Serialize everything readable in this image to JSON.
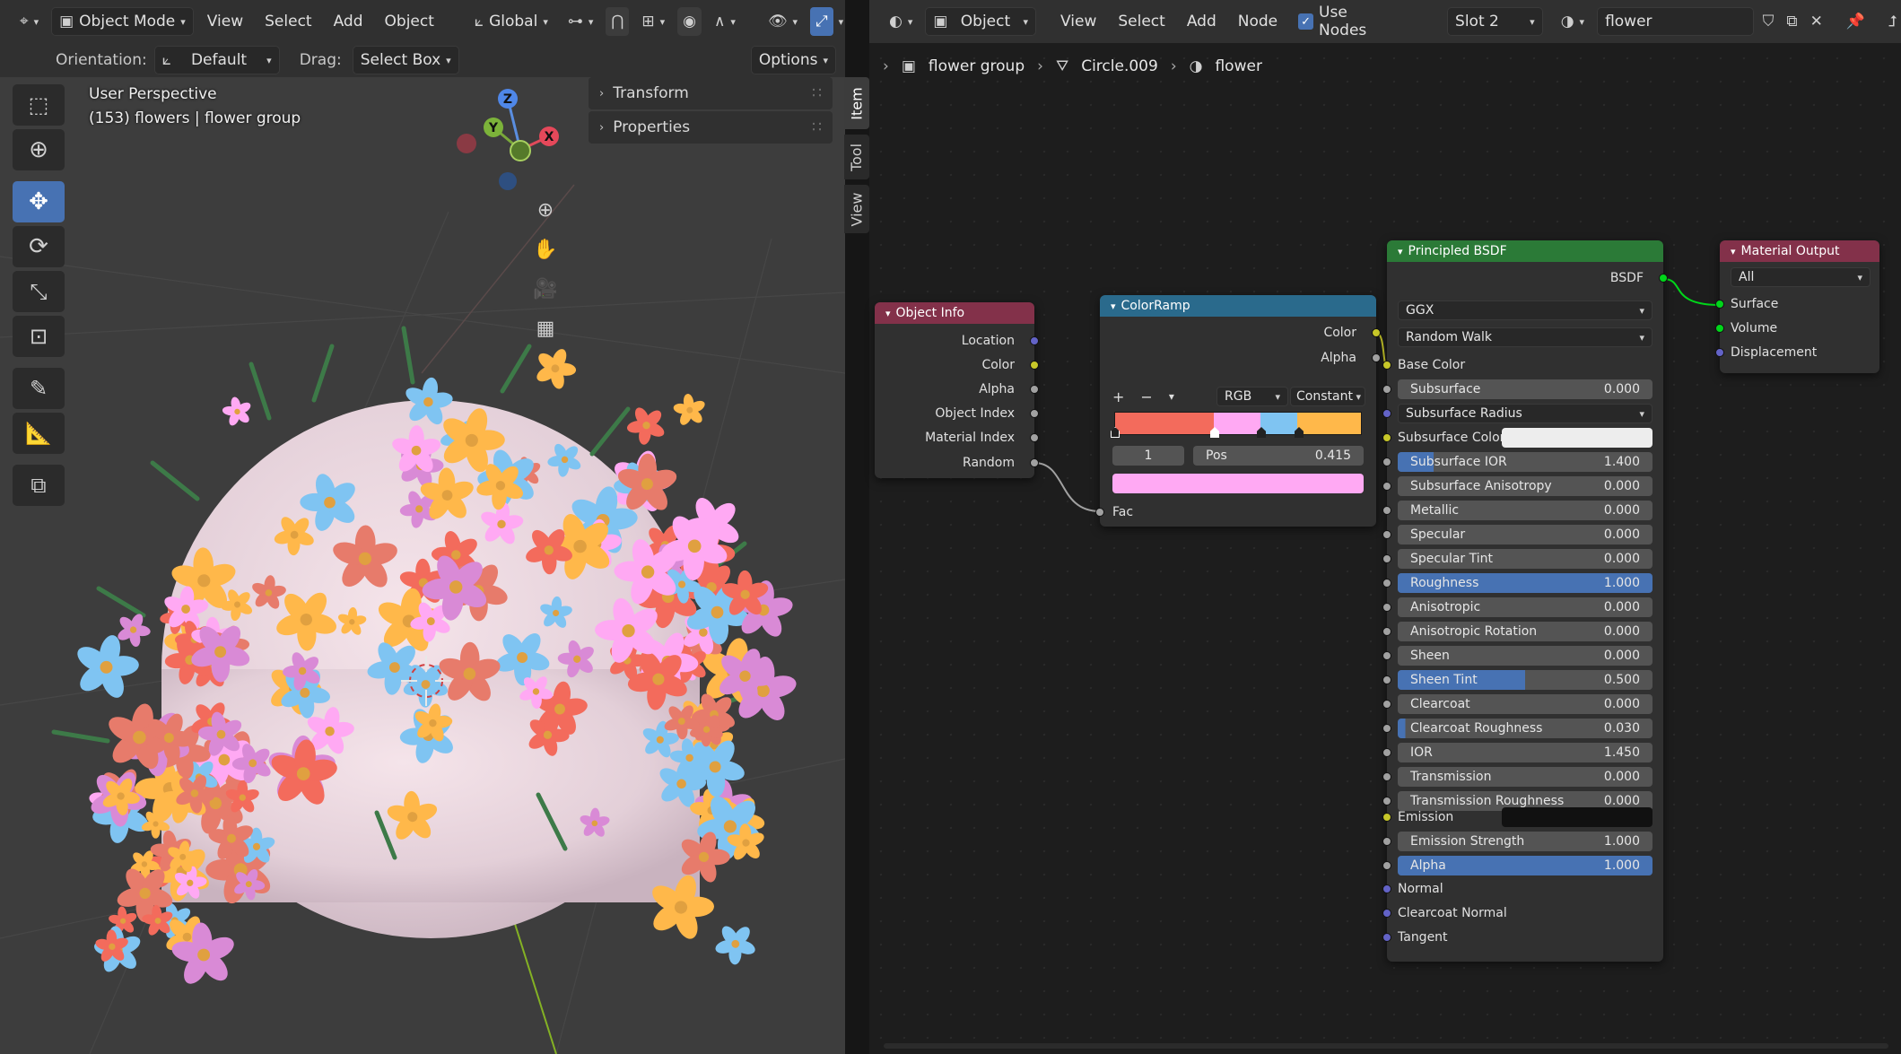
{
  "viewport": {
    "header": {
      "mode": "Object Mode",
      "menus": [
        "View",
        "Select",
        "Add",
        "Object"
      ],
      "transform_orientation": "Global"
    },
    "subheader": {
      "orientation_label": "Orientation:",
      "orientation_value": "Default",
      "drag_label": "Drag:",
      "drag_value": "Select Box",
      "options": "Options"
    },
    "info": {
      "line1": "User Perspective",
      "line2": "(153) flowers | flower group"
    },
    "npanel": {
      "sections": [
        "Transform",
        "Properties"
      ],
      "tabs": [
        "Item",
        "Tool",
        "View"
      ]
    },
    "gizmo": {
      "z": "Z",
      "y": "Y",
      "x": "X"
    }
  },
  "node_editor": {
    "header": {
      "type": "Object",
      "menus": [
        "View",
        "Select",
        "Add",
        "Node"
      ],
      "use_nodes": "Use Nodes",
      "slot": "Slot 2",
      "material": "flower"
    },
    "breadcrumb": [
      "flower group",
      "Circle.009",
      "flower"
    ],
    "nodes": {
      "object_info": {
        "title": "Object Info",
        "outputs": [
          "Location",
          "Color",
          "Alpha",
          "Object Index",
          "Material Index",
          "Random"
        ]
      },
      "colorramp": {
        "title": "ColorRamp",
        "outputs": [
          "Color",
          "Alpha"
        ],
        "color_mode": "RGB",
        "interpolation": "Constant",
        "index": "1",
        "pos_label": "Pos",
        "pos_value": "0.415",
        "input": "Fac",
        "selected_color": "#ffa9f3",
        "stops": [
          "#f36b5c",
          "#ffa9f3",
          "#7fc4f2",
          "#ffb84a"
        ]
      },
      "bsdf": {
        "title": "Principled BSDF",
        "output": "BSDF",
        "distribution": "GGX",
        "subsurface_method": "Random Walk",
        "base_color": "Base Color",
        "subsurface": {
          "label": "Subsurface",
          "value": "0.000"
        },
        "subsurface_radius": "Subsurface Radius",
        "subsurface_color": "Subsurface Color",
        "fields": [
          {
            "label": "Subsurface IOR",
            "value": "1.400"
          },
          {
            "label": "Subsurface Anisotropy",
            "value": "0.000"
          },
          {
            "label": "Metallic",
            "value": "0.000"
          },
          {
            "label": "Specular",
            "value": "0.000"
          },
          {
            "label": "Specular Tint",
            "value": "0.000"
          },
          {
            "label": "Roughness",
            "value": "1.000"
          },
          {
            "label": "Anisotropic",
            "value": "0.000"
          },
          {
            "label": "Anisotropic Rotation",
            "value": "0.000"
          },
          {
            "label": "Sheen",
            "value": "0.000"
          },
          {
            "label": "Sheen Tint",
            "value": "0.500"
          },
          {
            "label": "Clearcoat",
            "value": "0.000"
          },
          {
            "label": "Clearcoat Roughness",
            "value": "0.030"
          },
          {
            "label": "IOR",
            "value": "1.450"
          },
          {
            "label": "Transmission",
            "value": "0.000"
          },
          {
            "label": "Transmission Roughness",
            "value": "0.000"
          }
        ],
        "emission": "Emission",
        "emission_strength": {
          "label": "Emission Strength",
          "value": "1.000"
        },
        "alpha": {
          "label": "Alpha",
          "value": "1.000"
        },
        "normal": "Normal",
        "clearcoat_normal": "Clearcoat Normal",
        "tangent": "Tangent"
      },
      "material_output": {
        "title": "Material Output",
        "target": "All",
        "inputs": [
          "Surface",
          "Volume",
          "Displacement"
        ]
      }
    }
  }
}
